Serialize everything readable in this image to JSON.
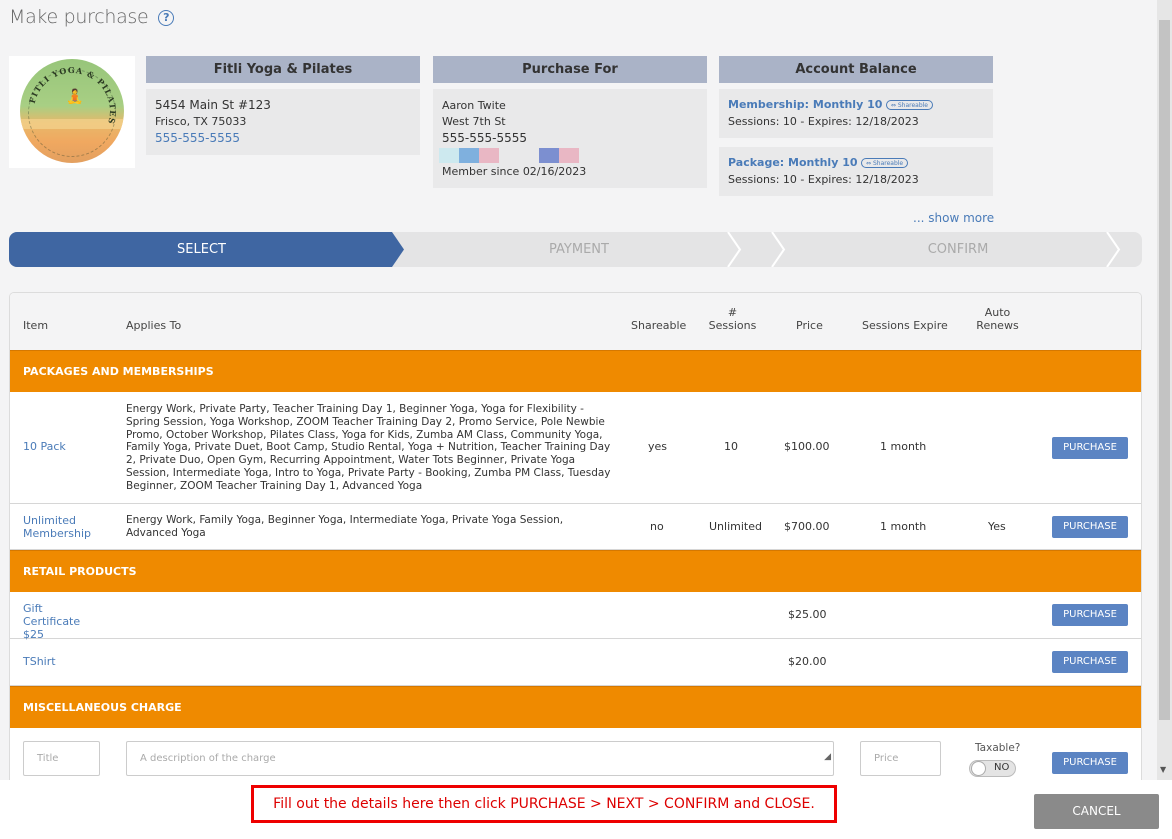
{
  "header": {
    "title": "Make purchase",
    "help_icon": "question-circle-icon"
  },
  "studio": {
    "name": "Fitli Yoga & Pilates",
    "address1": "5454 Main St #123",
    "address2": "Frisco, TX 75033",
    "phone": "555-555-5555",
    "logo_text": "FITLI YOGA & PILATES"
  },
  "purchase_for": {
    "heading": "Purchase For",
    "name": "Aaron Twite",
    "street": "West 7th St",
    "phone": "555-555-5555",
    "member_since": "Member since 02/16/2023",
    "swatch_colors": [
      "#cde9ef",
      "#7fb0de",
      "#e9b7c4",
      "#7c8fd0",
      "#e9b7c4"
    ]
  },
  "balance": {
    "heading": "Account Balance",
    "items": [
      {
        "name": "Membership: Monthly 10",
        "tag": "Shareable",
        "detail": "Sessions: 10 -  Expires: 12/18/2023"
      },
      {
        "name": "Package: Monthly 10",
        "tag": "Shareable",
        "detail": "Sessions: 10 -  Expires: 12/18/2023"
      }
    ],
    "show_more": "... show more"
  },
  "steps": [
    "SELECT",
    "PAYMENT",
    "CONFIRM"
  ],
  "table": {
    "headers": {
      "item": "Item",
      "applies_to": "Applies To",
      "shareable": "Shareable",
      "sessions_1": "#",
      "sessions_2": "Sessions",
      "price": "Price",
      "expire": "Sessions Expire",
      "auto_1": "Auto",
      "auto_2": "Renews"
    },
    "sections": {
      "packages": "PACKAGES AND MEMBERSHIPS",
      "retail": "RETAIL PRODUCTS",
      "misc": "MISCELLANEOUS CHARGE"
    },
    "packages": [
      {
        "item": "10 Pack",
        "applies": "Energy Work, Private Party, Teacher Training Day 1, Beginner Yoga, Yoga for Flexibility - Spring Session, Yoga Workshop, ZOOM Teacher Training Day 2, Promo Service, Pole Newbie Promo, October Workshop, Pilates Class, Yoga for Kids, Zumba AM Class, Community Yoga, Family Yoga, Private Duet, Boot Camp, Studio Rental, Yoga + Nutrition, Teacher Training Day 2, Private Duo, Open Gym, Recurring Appointment, Water Tots Beginner, Private Yoga Session, Intermediate Yoga, Intro to Yoga, Private Party - Booking, Zumba PM Class, Tuesday Beginner, ZOOM Teacher Training Day 1, Advanced Yoga",
        "shareable": "yes",
        "sessions": "10",
        "price": "$100.00",
        "expire": "1 month",
        "auto": ""
      },
      {
        "item": "Unlimited Membership",
        "applies": "Energy Work, Family Yoga, Beginner Yoga, Intermediate Yoga, Private Yoga Session, Advanced Yoga",
        "shareable": "no",
        "sessions": "Unlimited",
        "price": "$700.00",
        "expire": "1 month",
        "auto": "Yes"
      }
    ],
    "retail": [
      {
        "item": "Gift Certificate $25",
        "price": "$25.00"
      },
      {
        "item": "TShirt",
        "price": "$20.00"
      }
    ],
    "misc": {
      "title_placeholder": "Title",
      "desc_placeholder": "A description of the charge",
      "price_placeholder": "Price",
      "taxable_label": "Taxable?",
      "taxable_value": "NO"
    },
    "purchase_label": "PURCHASE"
  },
  "footer": {
    "note": "Fill out the details here then click PURCHASE > NEXT > CONFIRM and CLOSE.",
    "cancel": "CANCEL"
  }
}
